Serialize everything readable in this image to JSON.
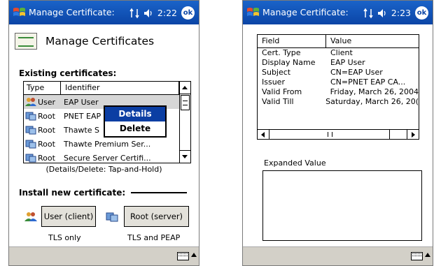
{
  "left": {
    "title": "Manage Certificate:",
    "time": "2:22",
    "ok_label": "ok",
    "heading": "Manage Certificates",
    "existing_label": "Existing certificates:",
    "columns": {
      "type": "Type",
      "identifier": "Identifier"
    },
    "rows": [
      {
        "type": "User",
        "identifier": "EAP User"
      },
      {
        "type": "Root",
        "identifier": "PNET EAP"
      },
      {
        "type": "Root",
        "identifier": "Thawte S"
      },
      {
        "type": "Root",
        "identifier": "Thawte Premium Ser..."
      },
      {
        "type": "Root",
        "identifier": "Secure Server Certifi..."
      }
    ],
    "context_menu": {
      "details": "Details",
      "delete": "Delete"
    },
    "hint": "(Details/Delete: Tap-and-Hold)",
    "install_label": "Install new certificate:",
    "user_button": "User (client)",
    "root_button": "Root (server)",
    "user_caption": "TLS only",
    "root_caption": "TLS and PEAP"
  },
  "right": {
    "title": "Manage Certificate:",
    "time": "2:23",
    "ok_label": "ok",
    "columns": {
      "field": "Field",
      "value": "Value"
    },
    "rows": [
      {
        "field": "Cert. Type",
        "value": "Client"
      },
      {
        "field": "Display Name",
        "value": "EAP User"
      },
      {
        "field": "Subject",
        "value": "CN=EAP User"
      },
      {
        "field": "Issuer",
        "value": "CN=PNET EAP CA..."
      },
      {
        "field": "Valid From",
        "value": "Friday, March 26, 2004"
      },
      {
        "field": "Valid Till",
        "value": "Saturday, March 26, 20("
      }
    ],
    "expanded_label": "Expanded Value",
    "expanded_value": ""
  },
  "colors": {
    "titlebar": "#0b45a6",
    "selection": "#0b3ea3",
    "bar": "#d3d0c8"
  }
}
